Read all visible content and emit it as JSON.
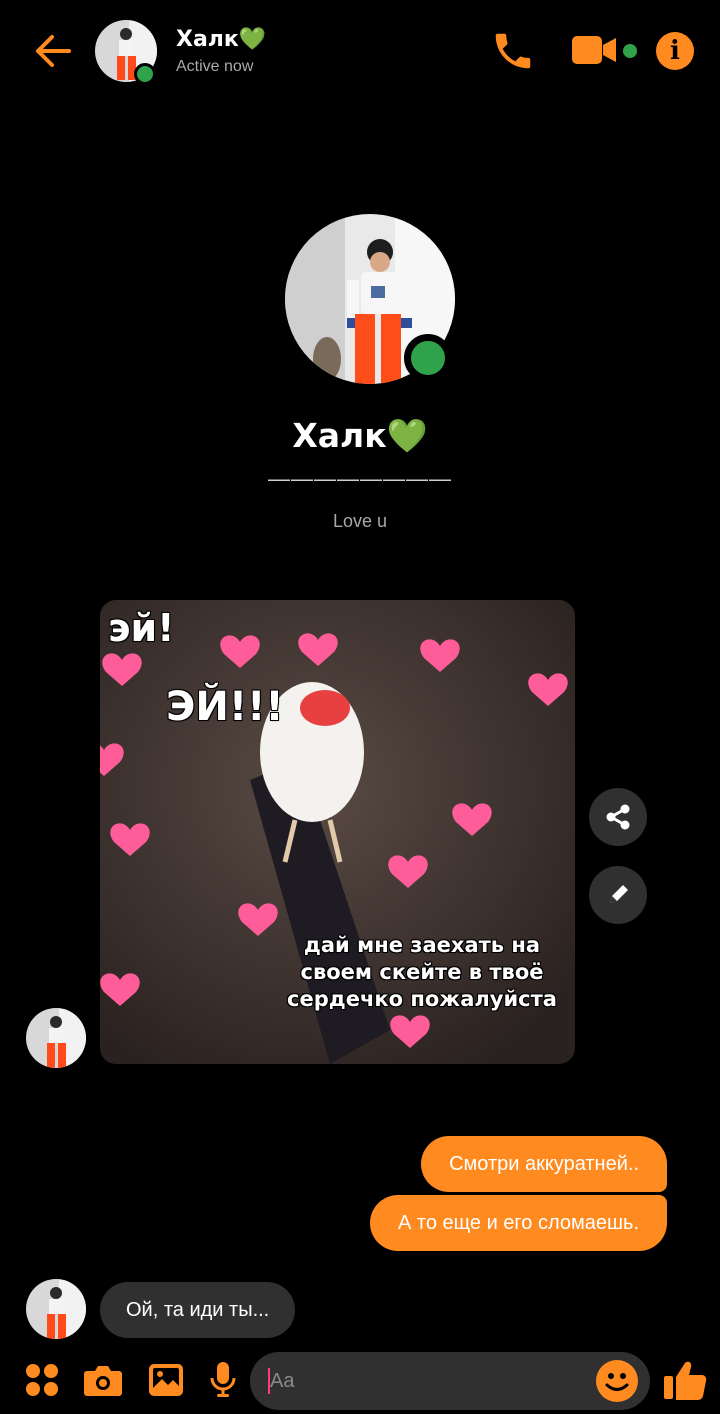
{
  "header": {
    "contact_name": "Халк💚",
    "status": "Active now",
    "icons": [
      "back-arrow-icon",
      "phone-icon",
      "video-camera-icon",
      "info-icon"
    ]
  },
  "profile": {
    "name": "Халк💚",
    "divider": "————————",
    "bio": "Love u"
  },
  "messages": {
    "meme_image": {
      "text_1": "эй!",
      "text_2": "ЭЙ!!!",
      "caption": "дай мне заехать на своем скейте в твоё сердечко пожалуйста"
    },
    "outgoing": [
      "Смотри аккуратней..",
      "А то еще и его сломаешь."
    ],
    "incoming": "Ой, та иди ты..."
  },
  "composer": {
    "placeholder": "Aa",
    "icons": [
      "menu-dots-icon",
      "camera-icon",
      "gallery-icon",
      "microphone-icon",
      "emoji-icon",
      "thumbs-up-icon"
    ]
  },
  "colors": {
    "accent": "#ff8a1f",
    "online": "#31a24c",
    "bubble_incoming": "#303030",
    "background": "#000000"
  }
}
